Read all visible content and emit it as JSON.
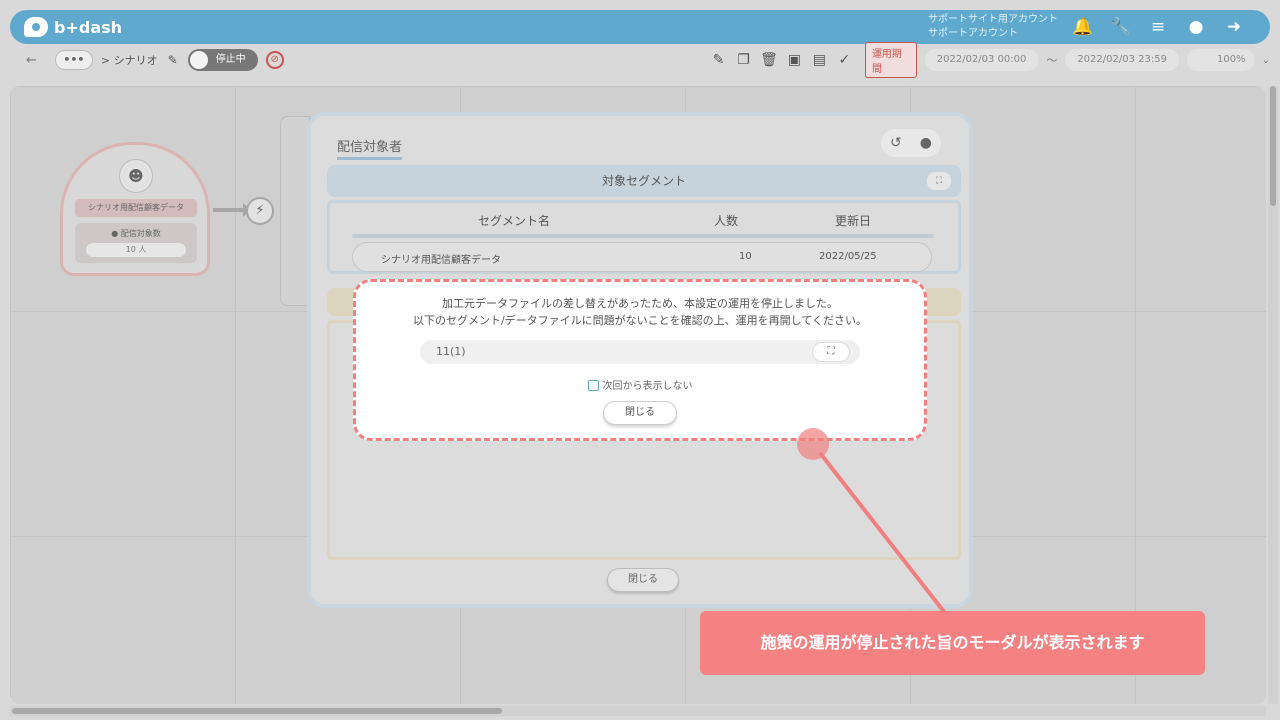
{
  "header": {
    "logo_text": "b+dash",
    "account_line1": "サポートサイト用アカウント",
    "account_line2": "サポートアカウント",
    "icons": [
      "bell-icon",
      "wrench-icon",
      "grid-icon",
      "chat-icon",
      "logout-icon"
    ]
  },
  "toolbar": {
    "back": "←",
    "ellipsis": "•••",
    "breadcrumb": "> シナリオ",
    "status_toggle": "停止中",
    "period_button": "運用期間",
    "start_date": "2022/02/03 00:00",
    "tilde": "〜",
    "end_date": "2022/02/03 23:59",
    "zoom": "100%"
  },
  "canvas": {
    "node_name": "シナリオ用配信顧客データ",
    "node_count_label": "配信対象数",
    "node_count_value": "10 人"
  },
  "modal": {
    "title": "配信対象者",
    "segment_header": "対象セグメント",
    "columns": [
      "セグメント名",
      "人数",
      "更新日"
    ],
    "rows": [
      {
        "name": "シナリオ用配信顧客データ",
        "count": "10",
        "updated": "2022/05/25"
      }
    ],
    "close_label": "閉じる"
  },
  "alert": {
    "line1": "加工元データファイルの差し替えがあったため、本設定の運用を停止しました。",
    "line2": "以下のセグメント/データファイルに問題がないことを確認の上、運用を再開してください。",
    "file_name": "11(1)",
    "checkbox_label": "次回から表示しない",
    "close_label": "閉じる"
  },
  "annotation": {
    "text": "施策の運用が停止された旨のモーダルが表示されます",
    "color": "#f48282"
  },
  "colors": {
    "brand": "#5fa9cf",
    "alert_border": "#f08080",
    "stopped": "#c9544d"
  }
}
